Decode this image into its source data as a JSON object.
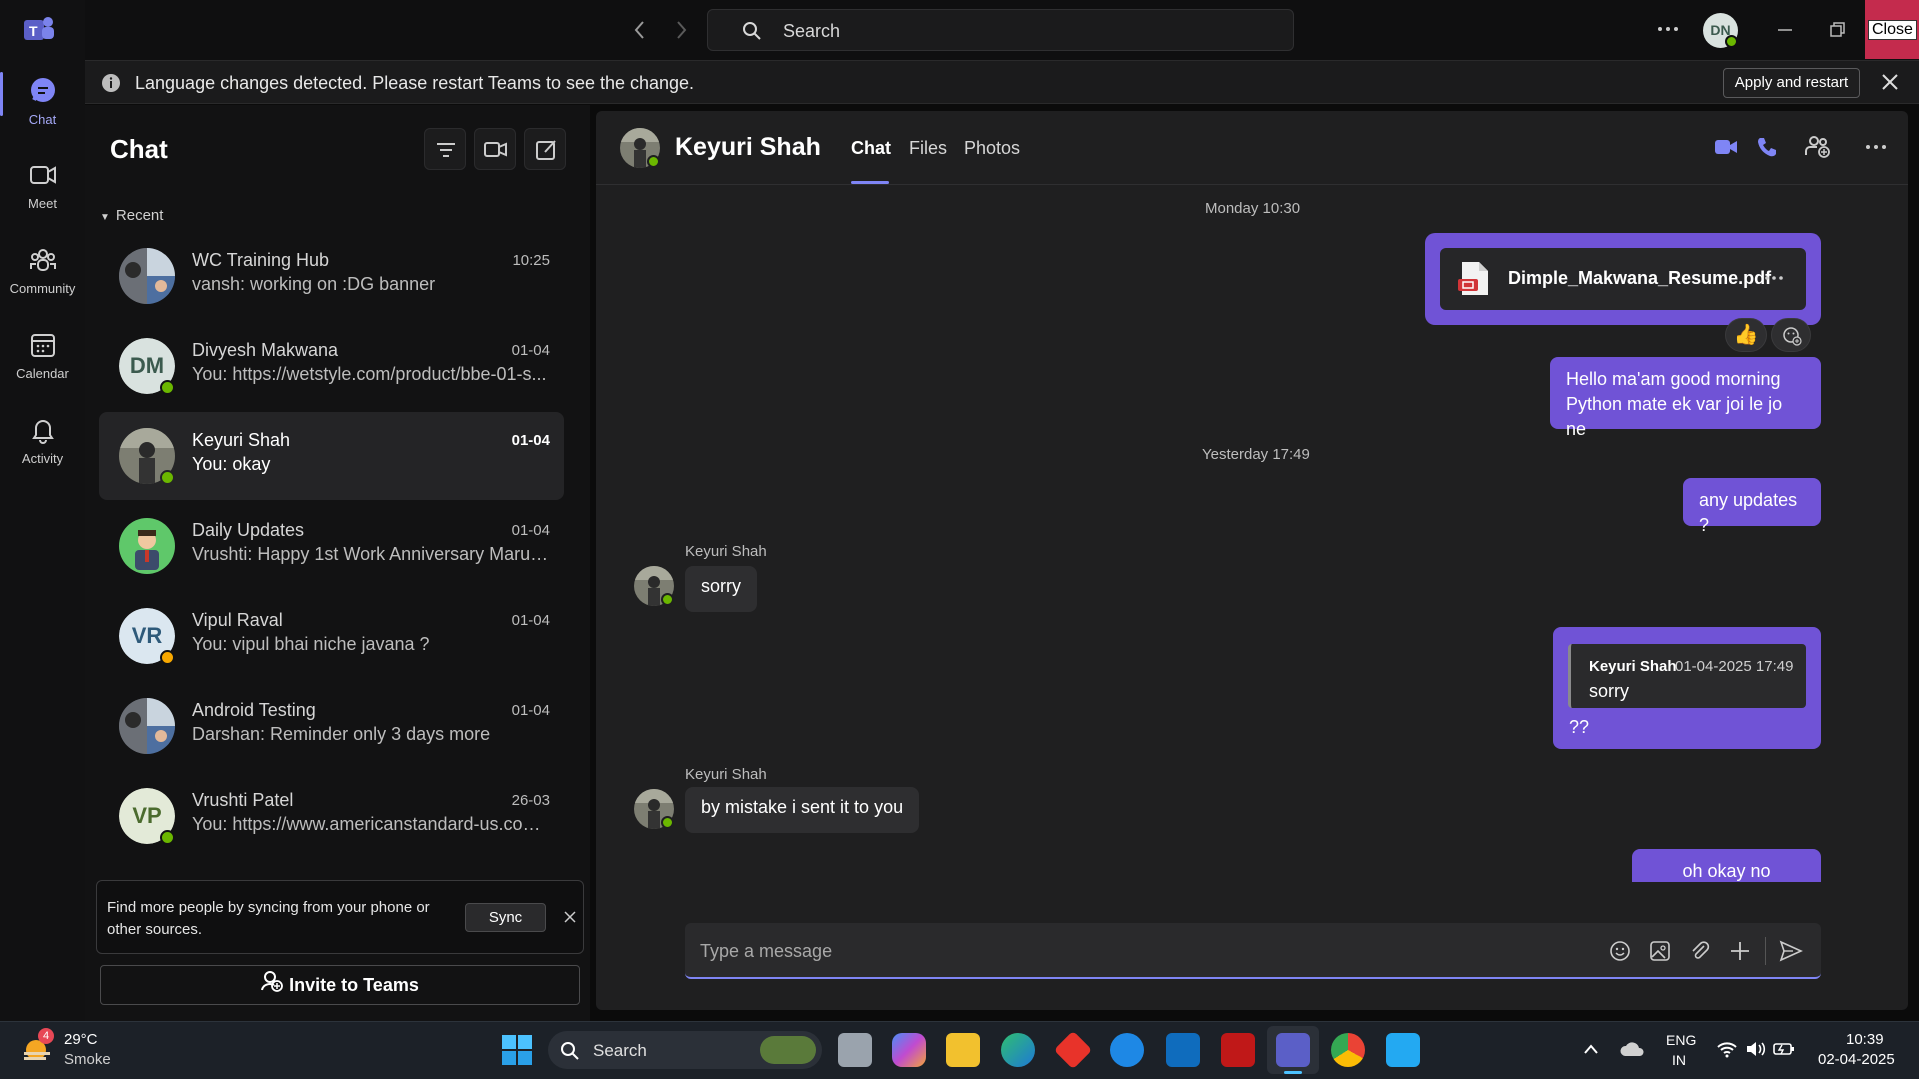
{
  "titlebar": {
    "search_placeholder": "Search",
    "user_initials": "DN",
    "close_label": "Close"
  },
  "rail": {
    "items": [
      {
        "label": "Chat",
        "icon": "chat-icon",
        "active": true
      },
      {
        "label": "Meet",
        "icon": "video-icon"
      },
      {
        "label": "Community",
        "icon": "community-icon"
      },
      {
        "label": "Calendar",
        "icon": "calendar-icon"
      },
      {
        "label": "Activity",
        "icon": "bell-icon"
      }
    ]
  },
  "banner": {
    "text": "Language changes detected. Please restart Teams to see the change.",
    "apply_label": "Apply and restart"
  },
  "chatlist": {
    "title": "Chat",
    "section": "Recent",
    "items": [
      {
        "name": "WC Training Hub",
        "preview": "vansh: working on :DG banner",
        "time": "10:25",
        "avatar": "group"
      },
      {
        "name": "Divyesh Makwana",
        "preview": "You: https://wetstyle.com/product/bbe-01-s...",
        "time": "01-04",
        "initials": "DM",
        "status": "online"
      },
      {
        "name": "Keyuri Shah",
        "preview": "You: okay",
        "time": "01-04",
        "avatar": "photo",
        "status": "online",
        "selected": true
      },
      {
        "name": "Daily Updates",
        "preview": "Vrushti: Happy 1st Work Anniversary Marut ...",
        "time": "01-04",
        "avatar": "cartoon"
      },
      {
        "name": "Vipul Raval",
        "preview": "You: vipul bhai  niche javana ?",
        "time": "01-04",
        "initials": "VR",
        "status": "away"
      },
      {
        "name": "Android Testing",
        "preview": "Darshan: Reminder only 3 days more",
        "time": "01-04",
        "avatar": "group"
      },
      {
        "name": "Vrushti Patel",
        "preview": "You: https://www.americanstandard-us.com/...",
        "time": "26-03",
        "initials": "VP",
        "status": "online"
      }
    ],
    "sync_text": "Find more people by syncing from your phone or other sources.",
    "sync_label": "Sync",
    "invite_label": "Invite to Teams"
  },
  "conversation": {
    "name": "Keyuri Shah",
    "tabs": [
      "Chat",
      "Files",
      "Photos"
    ],
    "day1": "Monday 10:30",
    "file_name": "Dimple_Makwana_Resume.pdf",
    "msg1_line1": "Hello ma'am good morning",
    "msg1_line2": "Python mate ek var joi le jo ne",
    "day2": "Yesterday 17:49",
    "msg2": "any updates ?",
    "sender": "Keyuri Shah",
    "them1": "sorry",
    "quote_sender": "Keyuri Shah",
    "quote_time": "01-04-2025 17:49",
    "quote_text": "sorry",
    "msg3": "??",
    "them2": "by mistake i sent it to you",
    "msg4": "oh okay no problem",
    "composer_placeholder": "Type a message"
  },
  "taskbar": {
    "weather_temp": "29°C",
    "weather_desc": "Smoke",
    "weather_badge": "4",
    "search_label": "Search",
    "lang_line1": "ENG",
    "lang_line2": "IN",
    "clock_time": "10:39",
    "clock_date": "02-04-2025"
  },
  "colors": {
    "accent": "#7f85f5",
    "my_bubble": "#7053d6",
    "online": "#6bb700",
    "away": "#f8a800",
    "close": "#c42b4d"
  }
}
